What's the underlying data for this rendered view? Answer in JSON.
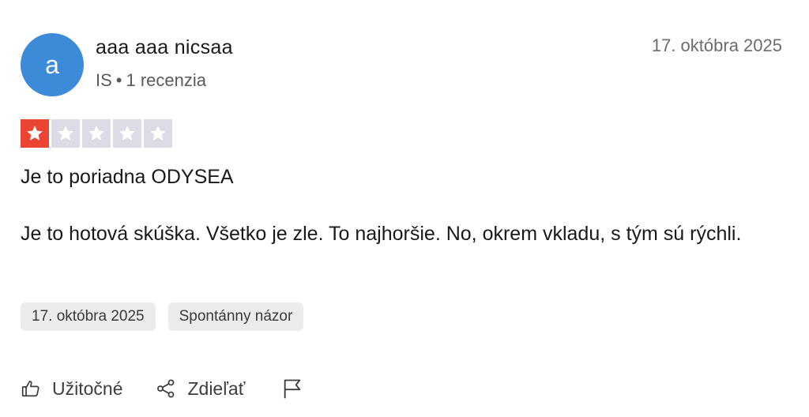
{
  "colors": {
    "avatar": "#3d8bd8",
    "star_filled": "#ec4433",
    "star_empty": "#dcdce6"
  },
  "reviewer": {
    "avatar_letter": "a",
    "name": "aaa aaa nicsaa",
    "country": "IS",
    "separator": "•",
    "review_count": "1 recenzia"
  },
  "review": {
    "date": "17. októbra 2025",
    "rating": 1,
    "max_rating": 5,
    "title": "Je to poriadna ODYSEA",
    "body": "Je to hotová skúška. Všetko je zle. To najhoršie. No, okrem vkladu, s tým sú rýchli."
  },
  "chips": {
    "experience_date": "17. októbra 2025",
    "label": "Spontánny názor"
  },
  "actions": {
    "useful_label": "Užitočné",
    "useful_icon": "thumbs-up-icon",
    "share_label": "Zdieľať",
    "share_icon": "share-icon",
    "report_icon": "flag-icon"
  }
}
